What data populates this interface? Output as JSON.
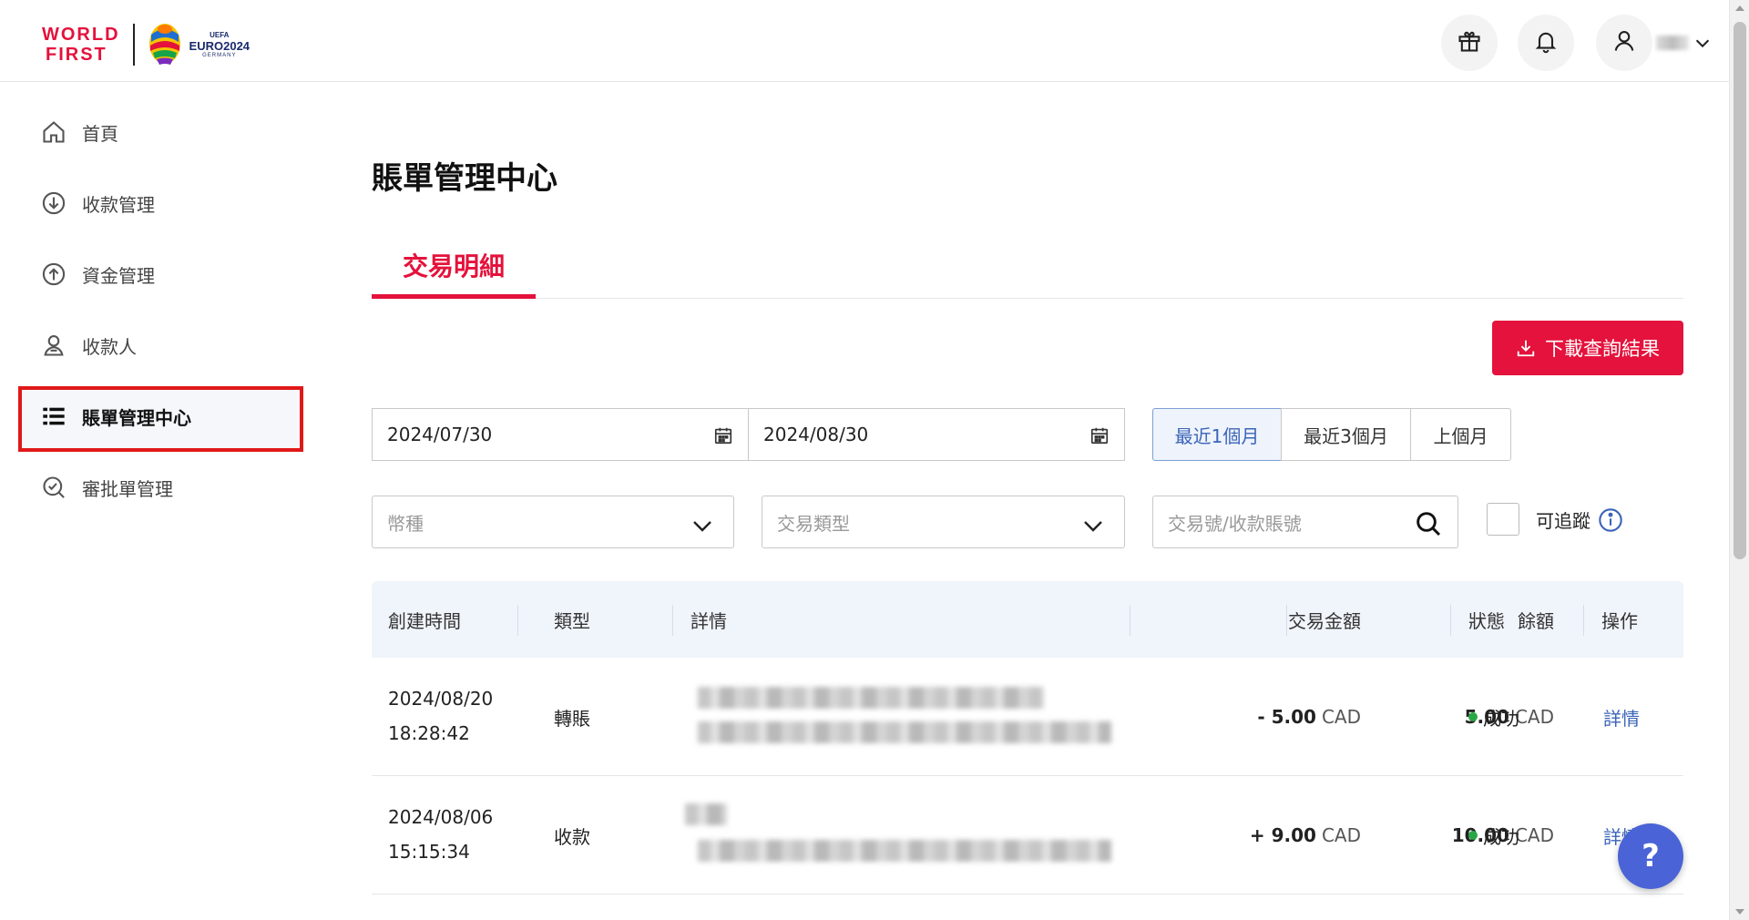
{
  "header": {
    "brand_line1": "WORLD",
    "brand_line2": "FIRST",
    "euro_uefa": "UEFA",
    "euro_title": "EURO2024",
    "euro_host": "GERMANY",
    "icons": [
      "gift-icon",
      "bell-icon",
      "user-icon",
      "chevron-down-icon"
    ]
  },
  "sidebar": {
    "items": [
      {
        "label": "首頁",
        "icon": "home-icon"
      },
      {
        "label": "收款管理",
        "icon": "download-circle-icon"
      },
      {
        "label": "資金管理",
        "icon": "upload-circle-icon"
      },
      {
        "label": "收款人",
        "icon": "person-icon"
      },
      {
        "label": "賬單管理中心",
        "icon": "list-icon",
        "active": true
      },
      {
        "label": "審批單管理",
        "icon": "approval-icon"
      }
    ],
    "active_highlight_color": "#e01818"
  },
  "main": {
    "title": "賬單管理中心",
    "tabs": [
      {
        "label": "交易明細",
        "active": true
      }
    ],
    "download_button": "下載查詢結果",
    "date_from": "2024/07/30",
    "date_to": "2024/08/30",
    "range_buttons": [
      {
        "label": "最近1個月",
        "active": true
      },
      {
        "label": "最近3個月",
        "active": false
      },
      {
        "label": "上個月",
        "active": false
      }
    ],
    "currency_placeholder": "幣種",
    "type_placeholder": "交易類型",
    "search_placeholder": "交易號/收款賬號",
    "track_label": "可追蹤"
  },
  "table": {
    "headers": [
      "創建時間",
      "類型",
      "詳情",
      "交易金額",
      "餘額",
      "狀態",
      "操作"
    ],
    "rows": [
      {
        "date": "2024/08/20",
        "time": "18:28:42",
        "type": "轉賬",
        "amount": "- 5.00",
        "amount_currency": "CAD",
        "balance": "5.00",
        "balance_currency": "CAD",
        "status": "成功",
        "action": "詳情"
      },
      {
        "date": "2024/08/06",
        "time": "15:15:34",
        "type": "收款",
        "amount": "+ 9.00",
        "amount_currency": "CAD",
        "balance": "10.00",
        "balance_currency": "CAD",
        "status": "成功",
        "action": "詳情"
      }
    ]
  },
  "help_button": "?",
  "colors": {
    "brand_red": "#e4123c",
    "link_blue": "#3b64b8",
    "success_green": "#29a745",
    "help_blue": "#4a63d6"
  }
}
